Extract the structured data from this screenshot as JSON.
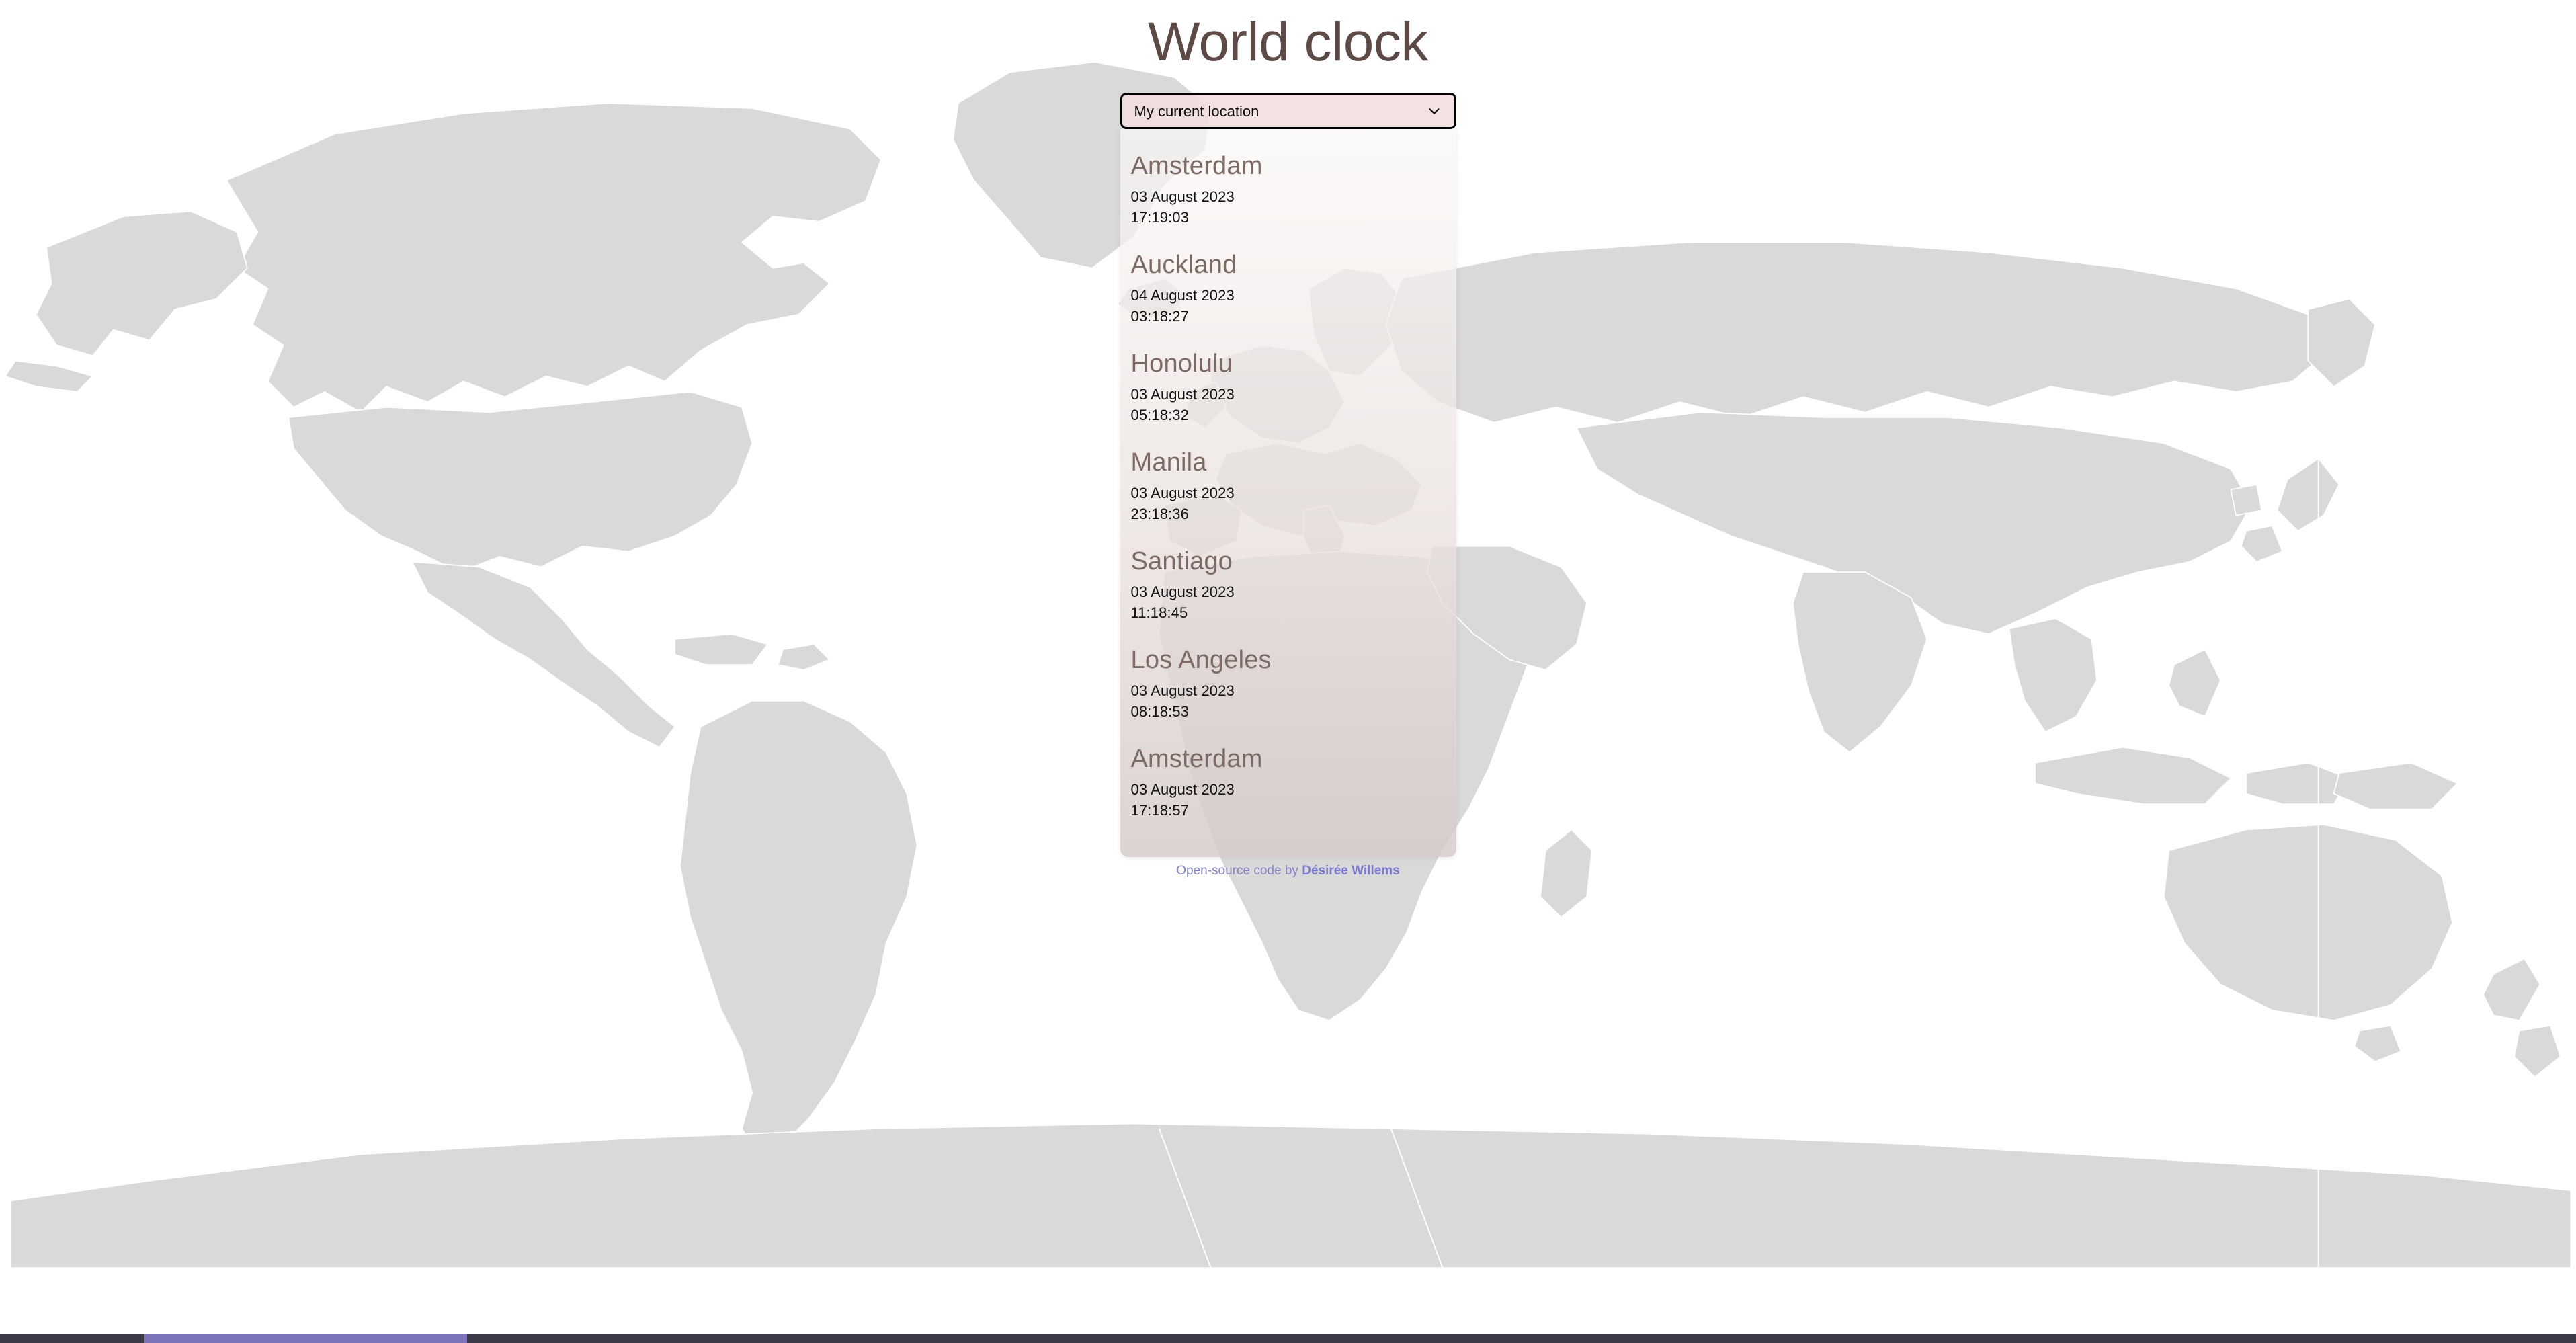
{
  "header": {
    "title": "World clock"
  },
  "location_select": {
    "name": "location-select",
    "selected": "My current location",
    "options": [
      "My current location",
      "Amsterdam",
      "Auckland",
      "Honolulu",
      "Manila",
      "Santiago",
      "Los Angeles"
    ],
    "chevron_icon": "chevron-down-icon",
    "background_color": "#f2dede",
    "border_color": "#000000"
  },
  "clocks": [
    {
      "city": "Amsterdam",
      "date": "03 August 2023",
      "time": "17:19:03"
    },
    {
      "city": "Auckland",
      "date": "04 August 2023",
      "time": "03:18:27"
    },
    {
      "city": "Honolulu",
      "date": "03 August 2023",
      "time": "05:18:32"
    },
    {
      "city": "Manila",
      "date": "03 August 2023",
      "time": "23:18:36"
    },
    {
      "city": "Santiago",
      "date": "03 August 2023",
      "time": "11:18:45"
    },
    {
      "city": "Los Angeles",
      "date": "03 August 2023",
      "time": "08:18:53"
    },
    {
      "city": "Amsterdam",
      "date": "03 August 2023",
      "time": "17:18:57"
    }
  ],
  "footer": {
    "prefix": "Open-source code by ",
    "author": "Désirée Willems",
    "text_color": "#8484c6",
    "link_color": "#7b7bd1"
  },
  "theme": {
    "title_color": "#5d4a47",
    "city_color": "#7d6a65",
    "body_text_color": "#111111",
    "map_land_color": "#d9d9d9",
    "page_background": "#ffffff",
    "panel_top_color": "#faf7f6",
    "panel_bottom_color": "#d5cbc9",
    "system_bar_color": "#3d3a47",
    "system_bar_accent": "#7b74b8"
  }
}
